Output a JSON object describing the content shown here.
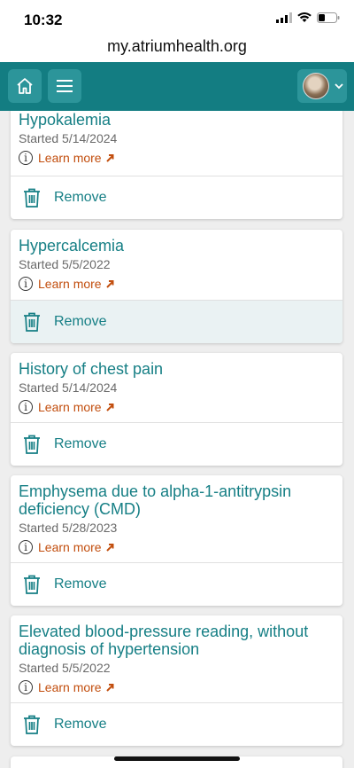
{
  "status": {
    "time": "10:32"
  },
  "browser": {
    "url": "my.atriumhealth.org"
  },
  "nav": {
    "home_icon": "home-icon",
    "menu_icon": "hamburger-menu-icon",
    "avatar_icon": "user-avatar"
  },
  "conditions": [
    {
      "title": "Hypokalemia",
      "started": "Started 5/14/2024",
      "learn_more": "Learn more",
      "remove": "Remove"
    },
    {
      "title": "Hypercalcemia",
      "started": "Started 5/5/2022",
      "learn_more": "Learn more",
      "remove": "Remove"
    },
    {
      "title": "History of chest pain",
      "started": "Started 5/14/2024",
      "learn_more": "Learn more",
      "remove": "Remove"
    },
    {
      "title": "Emphysema due to alpha-1-antitrypsin deficiency (CMD)",
      "started": "Started 5/28/2023",
      "learn_more": "Learn more",
      "remove": "Remove"
    },
    {
      "title": "Elevated blood-pressure reading, without diagnosis of hypertension",
      "started": "Started 5/5/2022",
      "learn_more": "Learn more",
      "remove": "Remove"
    }
  ],
  "colors": {
    "brand": "#137d82",
    "link": "#167f85",
    "learn_more": "#c24e0e"
  }
}
